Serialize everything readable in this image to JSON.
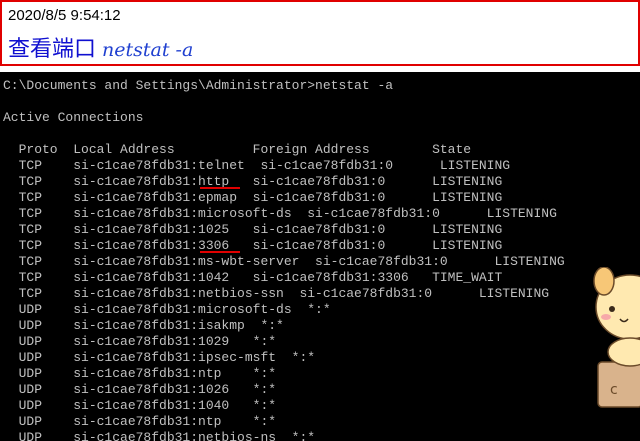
{
  "note": {
    "timestamp": "2020/8/5 9:54:12",
    "title_cn": "查看端口",
    "title_cmd": "netstat -a"
  },
  "console": {
    "lines": [
      "C:\\Documents and Settings\\Administrator>netstat -a",
      "",
      "Active Connections",
      "",
      "  Proto  Local Address          Foreign Address        State",
      "  TCP    si-c1cae78fdb31:telnet  si-c1cae78fdb31:0      LISTENING",
      "  TCP    si-c1cae78fdb31:http   si-c1cae78fdb31:0      LISTENING",
      "  TCP    si-c1cae78fdb31:epmap  si-c1cae78fdb31:0      LISTENING",
      "  TCP    si-c1cae78fdb31:microsoft-ds  si-c1cae78fdb31:0      LISTENING",
      "  TCP    si-c1cae78fdb31:1025   si-c1cae78fdb31:0      LISTENING",
      "  TCP    si-c1cae78fdb31:3306   si-c1cae78fdb31:0      LISTENING",
      "  TCP    si-c1cae78fdb31:ms-wbt-server  si-c1cae78fdb31:0      LISTENING",
      "  TCP    si-c1cae78fdb31:1042   si-c1cae78fdb31:3306   TIME_WAIT",
      "  TCP    si-c1cae78fdb31:netbios-ssn  si-c1cae78fdb31:0      LISTENING",
      "  UDP    si-c1cae78fdb31:microsoft-ds  *:*",
      "  UDP    si-c1cae78fdb31:isakmp  *:*",
      "  UDP    si-c1cae78fdb31:1029   *:*",
      "  UDP    si-c1cae78fdb31:ipsec-msft  *:*",
      "  UDP    si-c1cae78fdb31:ntp    *:*",
      "  UDP    si-c1cae78fdb31:1026   *:*",
      "  UDP    si-c1cae78fdb31:1040   *:*",
      "  UDP    si-c1cae78fdb31:ntp    *:*",
      "  UDP    si-c1cae78fdb31:netbios-ns  *:*"
    ]
  }
}
